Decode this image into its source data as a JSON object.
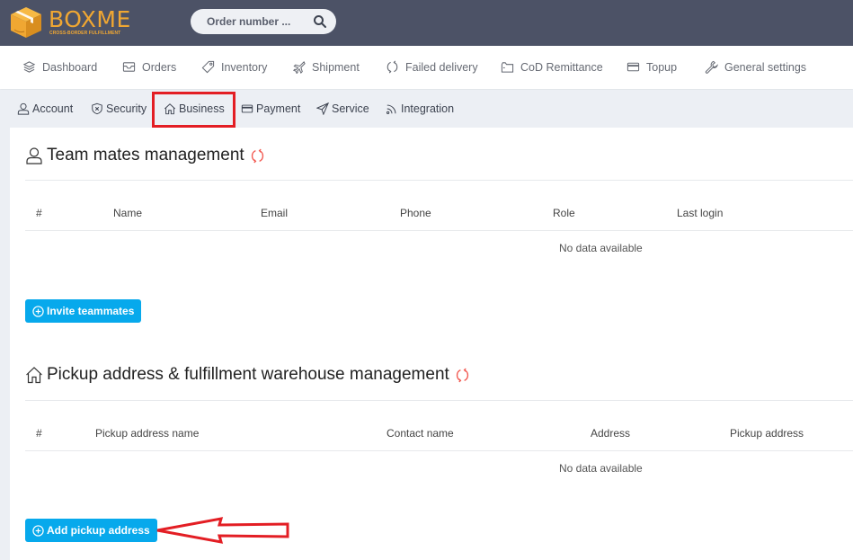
{
  "brand": {
    "name": "BOXME",
    "tagline": "CROSS-BORDER FULFILLMENT",
    "color": "#f0a732"
  },
  "search": {
    "placeholder": "Order number ...",
    "value": "",
    "icon": "search-icon"
  },
  "main_nav": [
    {
      "label": "Dashboard",
      "icon": "layers-icon"
    },
    {
      "label": "Orders",
      "icon": "inbox-icon"
    },
    {
      "label": "Inventory",
      "icon": "tag-icon"
    },
    {
      "label": "Shipment",
      "icon": "plane-icon"
    },
    {
      "label": "Failed delivery",
      "icon": "refresh-icon"
    },
    {
      "label": "CoD Remittance",
      "icon": "wallet-icon"
    },
    {
      "label": "Topup",
      "icon": "credit-card-icon"
    },
    {
      "label": "General settings",
      "icon": "wrench-icon"
    }
  ],
  "sub_tabs": [
    {
      "label": "Account",
      "icon": "user-icon"
    },
    {
      "label": "Security",
      "icon": "shield-icon"
    },
    {
      "label": "Business",
      "icon": "home-icon",
      "active": true
    },
    {
      "label": "Payment",
      "icon": "credit-card-icon"
    },
    {
      "label": "Service",
      "icon": "send-icon"
    },
    {
      "label": "Integration",
      "icon": "rss-icon"
    }
  ],
  "teammates": {
    "title": "Team mates management",
    "columns": [
      "#",
      "Name",
      "Email",
      "Phone",
      "Role",
      "Last login"
    ],
    "rows": [],
    "empty_text": "No data available",
    "button_label": "Invite teammates"
  },
  "pickup": {
    "title": "Pickup address & fulfillment warehouse management",
    "columns": [
      "#",
      "Pickup address name",
      "Contact name",
      "Address",
      "Pickup address"
    ],
    "rows": [],
    "empty_text": "No data available",
    "button_label": "Add pickup address"
  },
  "colors": {
    "topbar": "#4c5266",
    "accent_button": "#07a9ec",
    "refresh_icon": "#f25c54",
    "annotation_red": "#e31e24"
  }
}
